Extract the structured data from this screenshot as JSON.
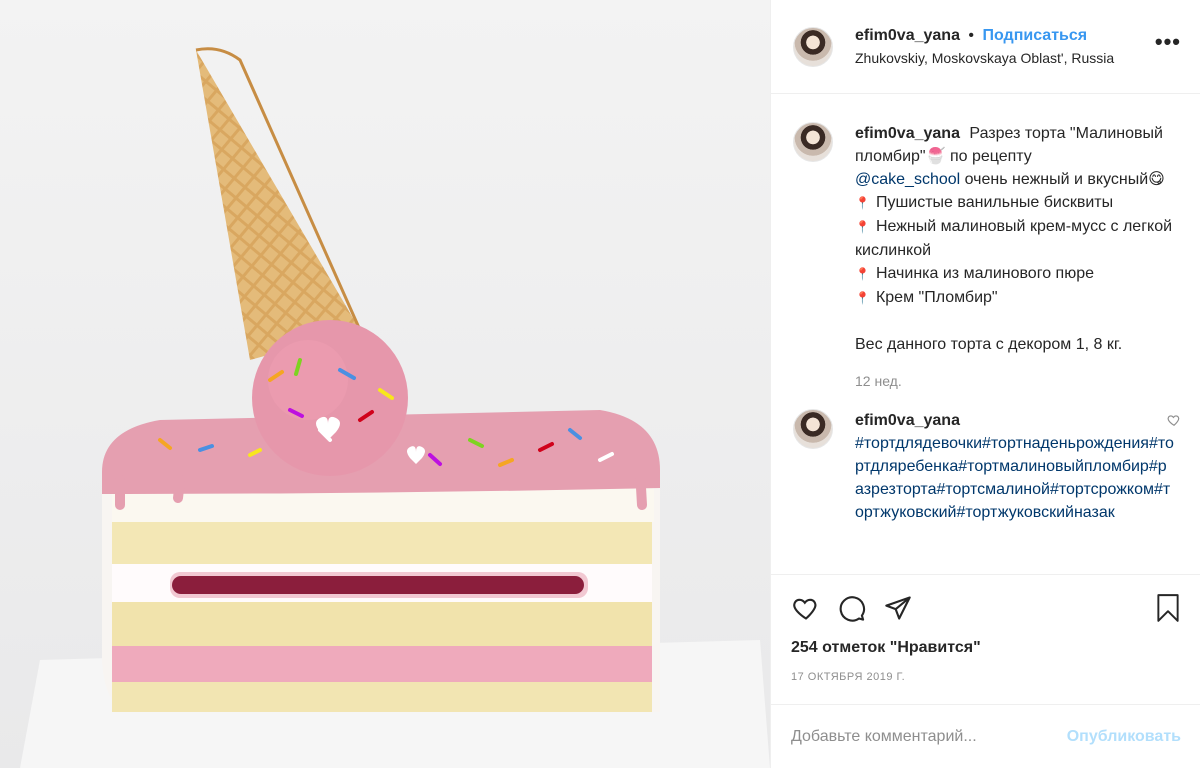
{
  "post": {
    "photo_alt": "",
    "author": "efim0va_yana",
    "separator": "•",
    "follow_label": "Подписаться",
    "location": "Zhukovskiy, Moskovskaya Oblast', Russia",
    "more_label": "•••"
  },
  "caption": {
    "author": "efim0va_yana",
    "line1": "Разрез торта \"Малиновый пломбир\"🍧 по рецепту",
    "mention": "@cake_school",
    "line2": " очень нежный и вкусный😋",
    "bullets": [
      "Пушистые ванильные бисквиты",
      "Нежный малиновый крем-мусс с легкой кислинкой",
      "Начинка из малинового пюре",
      "Крем \"Пломбир\""
    ],
    "weight": "Вес данного торта с декором 1, 8 кг.",
    "age": "12 нед."
  },
  "comment": {
    "author": "efim0va_yana",
    "tags": "#тортдлядевочки#тортнаденьрождения#тортдляребенка#тортмалиновыйпломбир#разрезторта#тортсмалиной#тортсрожком#тортжуковский#тортжуковскийназак"
  },
  "actions": {
    "likes": "254 отметок \"Нравится\"",
    "date": "17 ОКТЯБРЯ 2019 Г."
  },
  "add_comment": {
    "placeholder": "Добавьте комментарий...",
    "publish_label": "Опубликовать"
  },
  "colors": {
    "link": "#00376b",
    "follow": "#3897f0",
    "muted": "#8e8e8e",
    "publish_disabled": "#b2dffc"
  },
  "icons": [
    "heart-icon",
    "comment-icon",
    "share-icon",
    "bookmark-icon",
    "more-icon",
    "pin-icon"
  ]
}
